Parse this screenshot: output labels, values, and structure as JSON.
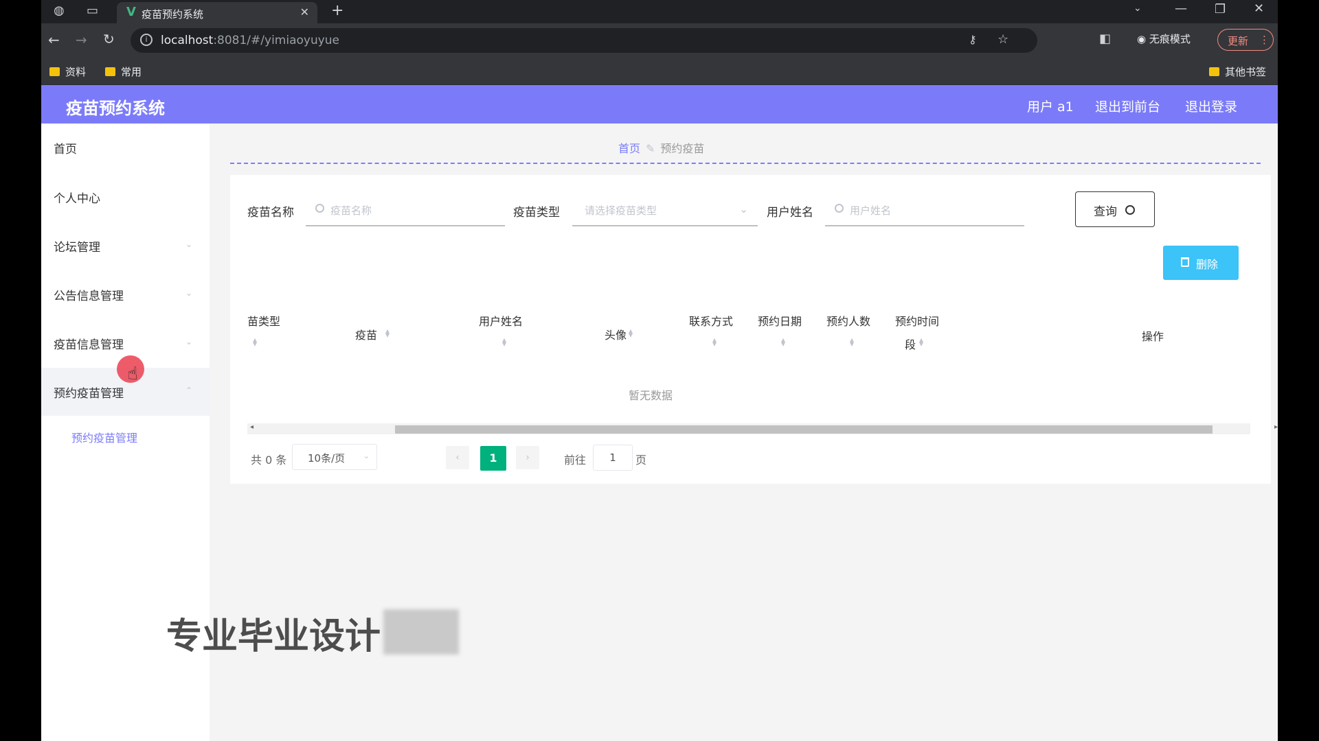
{
  "browser": {
    "tab_title": "疫苗预约系统",
    "url_host": "localhost",
    "url_path": ":8081/#/yimiaoyuyue",
    "incognito_label": "无痕模式",
    "update_label": "更新",
    "bookmarks": [
      "资料",
      "常用"
    ],
    "other_bookmarks": "其他书签"
  },
  "header": {
    "title": "疫苗预约系统",
    "user": "用户 a1",
    "to_front": "退出到前台",
    "logout": "退出登录"
  },
  "sidebar": {
    "items": [
      {
        "label": "首页"
      },
      {
        "label": "个人中心"
      },
      {
        "label": "论坛管理"
      },
      {
        "label": "公告信息管理"
      },
      {
        "label": "疫苗信息管理"
      },
      {
        "label": "预约疫苗管理"
      }
    ],
    "submenu": "预约疫苗管理"
  },
  "breadcrumb": {
    "home": "首页",
    "current": "预约疫苗"
  },
  "filters": {
    "vaccine_name_label": "疫苗名称",
    "vaccine_name_placeholder": "疫苗名称",
    "vaccine_type_label": "疫苗类型",
    "vaccine_type_placeholder": "请选择疫苗类型",
    "user_name_label": "用户姓名",
    "user_name_placeholder": "用户姓名",
    "query_label": "查询"
  },
  "actions": {
    "delete_label": "删除"
  },
  "table": {
    "headers": [
      "苗类型",
      "疫苗",
      "用户姓名",
      "头像",
      "联系方式",
      "预约日期",
      "预约人数",
      "预约时间",
      "段",
      "操作"
    ],
    "empty_text": "暂无数据"
  },
  "pagination": {
    "total": "共 0 条",
    "page_size": "10条/页",
    "current_page": "1",
    "goto_label": "前往",
    "goto_value": "1",
    "page_suffix": "页"
  },
  "overlay": {
    "watermark": "专业毕业设计"
  }
}
